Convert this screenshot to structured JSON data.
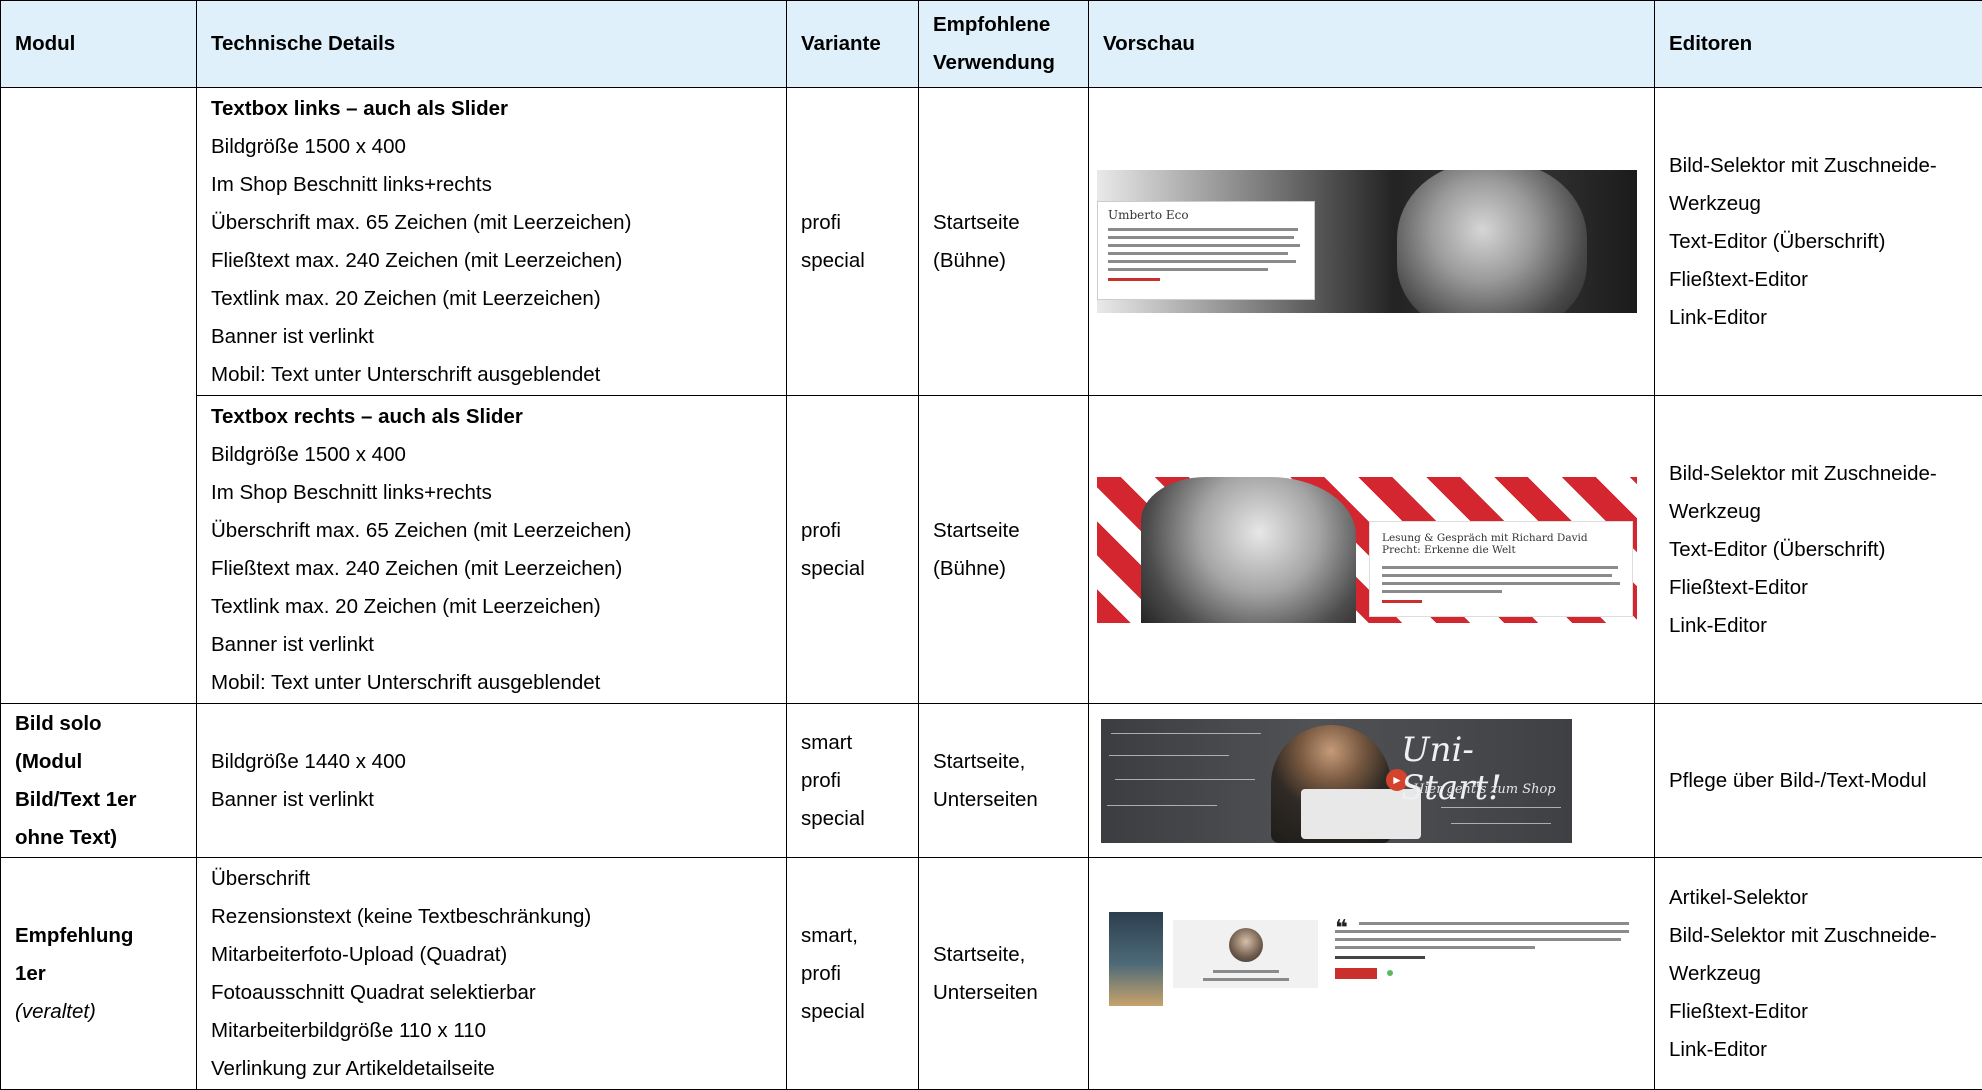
{
  "headers": [
    "Modul",
    "Technische Details",
    "Variante",
    "Empfohlene Verwendung",
    "Vorschau",
    "Editoren"
  ],
  "rows": [
    {
      "modul": [],
      "details_title": "Textbox links – auch als Slider",
      "details": [
        "Bildgröße 1500 x 400",
        "Im Shop Beschnitt links+rechts",
        "Überschrift max. 65 Zeichen (mit Leerzeichen)",
        "Fließtext max. 240 Zeichen (mit Leerzeichen)",
        "Textlink max. 20 Zeichen (mit Leerzeichen)",
        "Banner ist verlinkt",
        "Mobil: Text unter Unterschrift ausgeblendet"
      ],
      "variante": [
        "profi",
        "special"
      ],
      "verwendung": [
        "Startseite",
        "(Bühne)"
      ],
      "preview_caption": "Umberto Eco",
      "editoren": [
        "Bild-Selektor mit Zuschneide-",
        "Werkzeug",
        "Text-Editor (Überschrift)",
        "Fließtext-Editor",
        "Link-Editor"
      ]
    },
    {
      "modul": [],
      "details_title": "Textbox rechts – auch als Slider",
      "details": [
        "Bildgröße 1500 x 400",
        "Im Shop Beschnitt links+rechts",
        "Überschrift max. 65 Zeichen (mit Leerzeichen)",
        "Fließtext max. 240 Zeichen (mit Leerzeichen)",
        "Textlink max. 20 Zeichen (mit Leerzeichen)",
        "Banner ist verlinkt",
        "Mobil: Text unter Unterschrift ausgeblendet"
      ],
      "variante": [
        "profi",
        "special"
      ],
      "verwendung": [
        "Startseite",
        "(Bühne)"
      ],
      "preview_caption": "Lesung & Gespräch mit Richard David Precht: Erkenne die Welt",
      "editoren": [
        "Bild-Selektor mit Zuschneide-",
        "Werkzeug",
        "Text-Editor (Überschrift)",
        "Fließtext-Editor",
        "Link-Editor"
      ]
    },
    {
      "modul": [
        "Bild solo",
        "(Modul",
        "Bild/Text 1er",
        "ohne Text)"
      ],
      "details": [
        "Bildgröße 1440 x 400",
        "Banner ist verlinkt"
      ],
      "variante": [
        "smart",
        "profi",
        "special"
      ],
      "verwendung": [
        "Startseite,",
        "Unterseiten"
      ],
      "preview_title": "Uni-Start!",
      "preview_sub": "Hier geht's zum Shop",
      "editoren": [
        "Pflege über Bild-/Text-Modul"
      ]
    },
    {
      "modul": [
        "Empfehlung",
        "1er"
      ],
      "modul_note": "(veraltet)",
      "details": [
        "Überschrift",
        "Rezensionstext (keine Textbeschränkung)",
        "Mitarbeiterfoto-Upload (Quadrat)",
        "Fotoausschnitt Quadrat selektierbar",
        "Mitarbeiterbildgröße 110 x 110",
        "Verlinkung zur Artikeldetailseite"
      ],
      "variante": [
        "smart,",
        "profi",
        "special"
      ],
      "verwendung": [
        "Startseite,",
        "Unterseiten"
      ],
      "editoren": [
        "Artikel-Selektor",
        "Bild-Selektor mit Zuschneide-",
        "Werkzeug",
        "Fließtext-Editor",
        "Link-Editor"
      ]
    }
  ]
}
